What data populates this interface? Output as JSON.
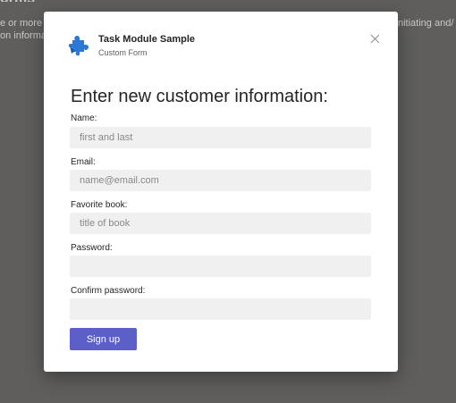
{
  "background": {
    "heading_fragment": "orms",
    "left_line_1": "e or more c",
    "left_line_2": "on informa",
    "right_line_1": "nitiating and/"
  },
  "dialog": {
    "app_title": "Task Module Sample",
    "app_subtitle": "Custom Form",
    "close_icon": "close-icon",
    "app_icon": "puzzle-piece-icon"
  },
  "form": {
    "heading": "Enter new customer information:",
    "fields": [
      {
        "label": "Name:",
        "placeholder": "first and last",
        "value": ""
      },
      {
        "label": "Email:",
        "placeholder": "name@email.com",
        "value": ""
      },
      {
        "label": "Favorite book:",
        "placeholder": "title of book",
        "value": ""
      },
      {
        "label": "Password:",
        "placeholder": "",
        "value": ""
      },
      {
        "label": "Confirm password:",
        "placeholder": "",
        "value": ""
      }
    ],
    "submit_label": "Sign up"
  },
  "colors": {
    "backdrop": "#5f5e5d",
    "accent": "#5b5fc7",
    "input_background": "#f0f0f0",
    "icon_blue": "#2b78d6"
  }
}
